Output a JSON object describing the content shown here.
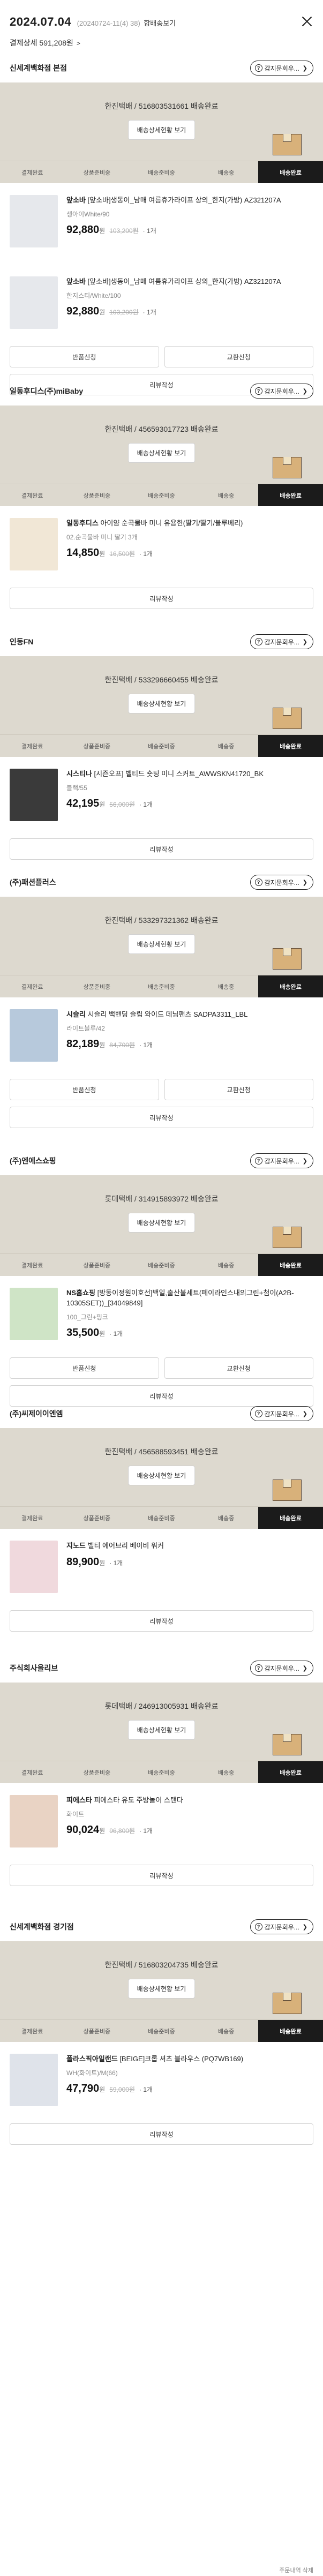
{
  "header": {
    "date": "2024.07.04",
    "date_sub": "(20240724-11(4) 38)",
    "combined_label": "합배송보기",
    "total": "결제상세 591,208원",
    "total_chev": ">"
  },
  "labels": {
    "inquiry": "감지문회우...",
    "track": "배송상세현황 보기",
    "return": "반품신청",
    "exchange": "교환신청",
    "review": "리뷰작성",
    "won": "원",
    "steps": [
      "결제완료",
      "상품준비중",
      "배송준비중",
      "배송중",
      "배송완료"
    ]
  },
  "orders": [
    {
      "store": "신세계백화점 본점",
      "status": "한진택배 / 516803531661 배송완료",
      "items": [
        {
          "brand": "앞소바",
          "title": "[앞소바]생동이_남매 여름휴가라이프 상의_한지(가방) AZ321207A",
          "option": "생아이White/90",
          "price": "92,880",
          "orig": "103,200원",
          "qty": "1개",
          "thumb": "#e6e8ec"
        },
        {
          "brand": "앞소바",
          "title": "[앞소바]생동이_남매 여름휴가라이프 상의_한지(가방) AZ321207A",
          "option": "한지스티/White/100",
          "price": "92,880",
          "orig": "103,200원",
          "qty": "1개",
          "thumb": "#e6e8ec"
        }
      ]
    },
    {
      "store": "일동후디스(주)miBaby",
      "status": "한진택배 / 456593017723 배송완료",
      "items": [
        {
          "brand": "일동후디스",
          "title": "아이얌 순곡물바 미니 유용한(딸기/딸기/블루베리)",
          "option": "02.순곡물바 미니 딸기 3개",
          "price": "14,850",
          "orig": "16,500원",
          "qty": "1개",
          "thumb": "#f1e7d6"
        }
      ]
    },
    {
      "store": "인동FN",
      "status": "한진택배 / 533296660455 배송완료",
      "items": [
        {
          "brand": "시스티나",
          "title": "[시즌오프] 벨티드 숏팅 미니 스커트_AWWSKN41720_BK",
          "option": "블랙/55",
          "price": "42,195",
          "orig": "56,000원",
          "qty": "1개",
          "thumb": "#3a3a3a"
        }
      ]
    },
    {
      "store": "(주)패션플러스",
      "status": "한진택배 / 533297321362 배송완료",
      "items": [
        {
          "brand": "시슬리",
          "title": "시슬리 백밴딩 슬림 와이드 데님팬츠 SADPA3311_LBL",
          "option": "라이트블루/42",
          "price": "82,189",
          "orig": "84,700원",
          "qty": "1개",
          "thumb": "#b7c9dc"
        }
      ]
    },
    {
      "store": "(주)엔에스쇼핑",
      "status": "롯데택배 / 314915893972 배송완료",
      "items": [
        {
          "brand": "NS홈쇼핑",
          "title": "[방동이정원이호선]백일,출산불세트(페이라인스내의그린+첨이(A2B-10305SET))_[34049849]",
          "option": "100_그린+핑크",
          "price": "35,500",
          "orig": "",
          "qty": "1개",
          "thumb": "#cfe4c6"
        }
      ]
    },
    {
      "store": "(주)씨제이이엔엠",
      "status": "한진택배 / 456588593451 배송완료",
      "items": [
        {
          "brand": "지노드",
          "title": "벨티 에어브리 베이비 워커",
          "option": "",
          "price": "89,900",
          "orig": "",
          "qty": "1개",
          "thumb": "#f0d9dd"
        }
      ]
    },
    {
      "store": "주식회사올리브",
      "status": "롯데택배 / 246913005931 배송완료",
      "items": [
        {
          "brand": "피에스타",
          "title": "피에스타 유도 주방놀이 스탠다",
          "option": "화이트",
          "price": "90,024",
          "orig": "96,800원",
          "qty": "1개",
          "thumb": "#e9d3c4"
        }
      ]
    },
    {
      "store": "신세계백화점 경기점",
      "status": "한진택배 / 516803204735 배송완료",
      "items": [
        {
          "brand": "폴라스픽아일랜드",
          "title": "[BEIGE]크롭 셔츠 블라우스 (PQ7WB169)",
          "option": "WH(화이트)/M(66)",
          "price": "47,790",
          "orig": "59,000원",
          "qty": "1개",
          "thumb": "#dfe3ea"
        }
      ]
    }
  ],
  "footer_hint": "주문내역 삭제"
}
